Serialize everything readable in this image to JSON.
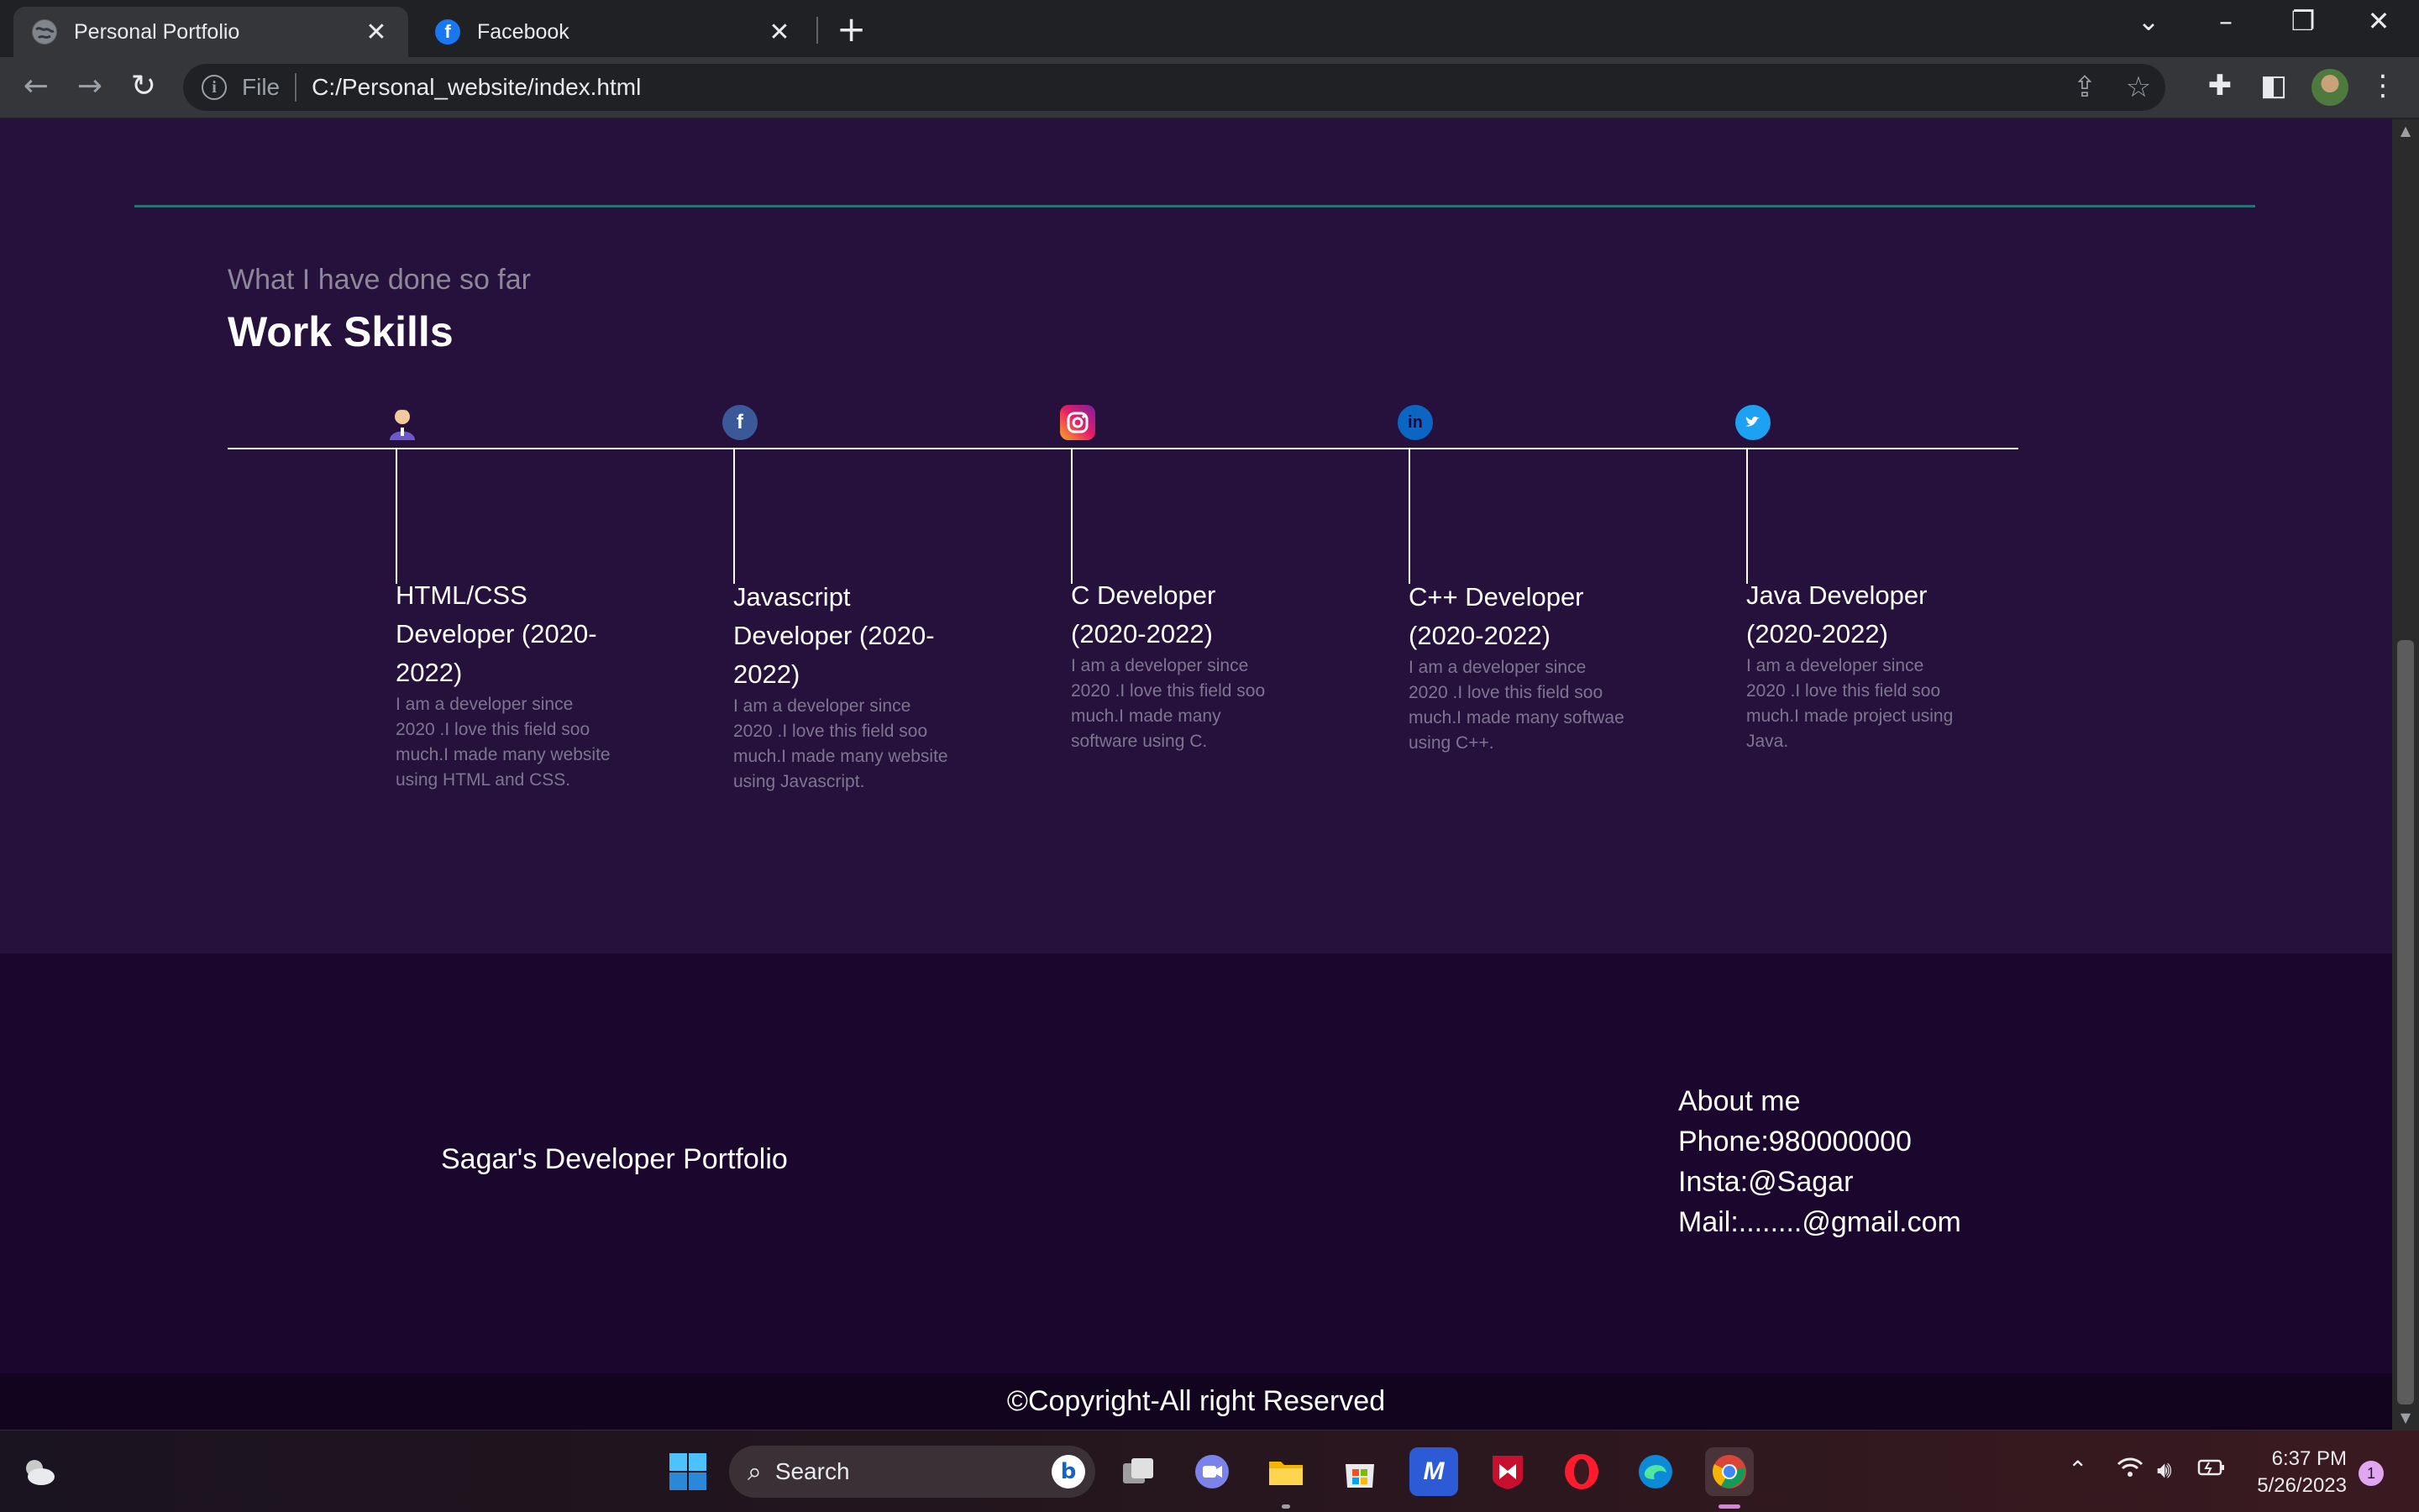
{
  "browser": {
    "tabs": [
      {
        "title": "Personal Portfolio",
        "favicon": "globe-icon",
        "active": true
      },
      {
        "title": "Facebook",
        "favicon": "facebook-icon",
        "active": false
      }
    ],
    "address": {
      "scheme_label": "File",
      "url": "C:/Personal_website/index.html"
    }
  },
  "page": {
    "section_subtitle": "What I have done so far",
    "section_title": "Work Skills",
    "skills": [
      {
        "icon": "developer-avatar-icon",
        "title": "HTML/CSS Developer (2020-2022)",
        "description": "I am a developer since 2020 .I love this field soo much.I made many website using HTML and CSS."
      },
      {
        "icon": "facebook-icon",
        "title": "Javascript Developer (2020-2022)",
        "description": "I am a developer since 2020 .I love this field soo much.I made many website using Javascript."
      },
      {
        "icon": "instagram-icon",
        "title": "C Developer (2020-2022)",
        "description": "I am a developer since 2020 .I love this field soo much.I made many software using C."
      },
      {
        "icon": "linkedin-icon",
        "title": "C++ Developer (2020-2022)",
        "description": "I am a developer since 2020 .I love this field soo much.I made many softwae using C++."
      },
      {
        "icon": "twitter-icon",
        "title": "Java Developer (2020-2022)",
        "description": "I am a developer since 2020 .I love this field soo much.I made project using Java."
      }
    ],
    "footer": {
      "brand": "Sagar's Developer Portfolio",
      "about_heading": "About me",
      "phone": "Phone:980000000",
      "insta": "Insta:@Sagar",
      "mail": "Mail:........@gmail.com"
    },
    "copyright": "©Copyright-All right Reserved"
  },
  "taskbar": {
    "search_label": "Search",
    "time": "6:37 PM",
    "date": "5/26/2023",
    "notification_count": "1"
  },
  "colors": {
    "page_bg": "#26103c",
    "footer_bg": "#1b062e",
    "copyright_bg": "#12031f",
    "divider": "#2a6f73",
    "muted_text": "#8d8799"
  }
}
